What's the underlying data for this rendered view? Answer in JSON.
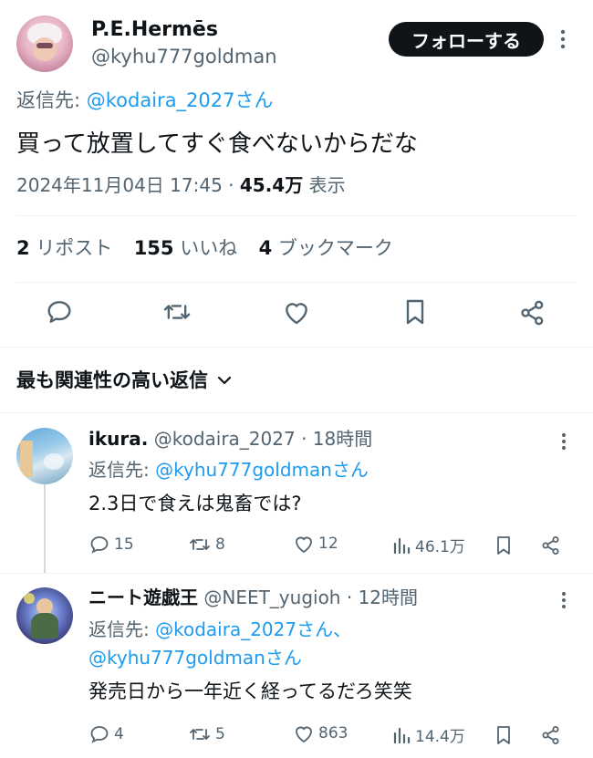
{
  "main_tweet": {
    "display_name": "P.E.Hermēs",
    "handle": "@kyhu777goldman",
    "follow_label": "フォローする",
    "reply_to_prefix": "返信先: ",
    "reply_to_handle": "@kodaira_2027さん",
    "text": "買って放置してすぐ食べないからだな",
    "timestamp": "2024年11月04日 17:45",
    "separator": " · ",
    "views_count": "45.4万",
    "views_label": " 表示",
    "stats": {
      "reposts_count": "2",
      "reposts_label": "リポスト",
      "likes_count": "155",
      "likes_label": "いいね",
      "bookmarks_count": "4",
      "bookmarks_label": "ブックマーク"
    }
  },
  "replies_section": {
    "sort_label": "最も関連性の高い返信"
  },
  "replies": [
    {
      "display_name": "ikura.",
      "handle": "@kodaira_2027",
      "time": "· 18時間",
      "reply_to_prefix": "返信先: ",
      "reply_to_line1": "@kyhu777goldmanさん",
      "reply_to_line2": "",
      "text": "2.3日で食えは鬼畜では?",
      "replies": "15",
      "reposts": "8",
      "likes": "12",
      "views": "46.1万"
    },
    {
      "display_name": "ニート遊戯王",
      "handle": "@NEET_yugioh",
      "time": "· 12時間",
      "reply_to_prefix": "返信先: ",
      "reply_to_line1": "@kodaira_2027さん、",
      "reply_to_line2": "@kyhu777goldmanさん",
      "text": "発売日から一年近く経ってるだろ笑笑",
      "replies": "4",
      "reposts": "5",
      "likes": "863",
      "views": "14.4万"
    }
  ],
  "colors": {
    "accent": "#1d9bf0",
    "text": "#0f1419",
    "muted": "#536471",
    "divider": "#eff3f4"
  }
}
